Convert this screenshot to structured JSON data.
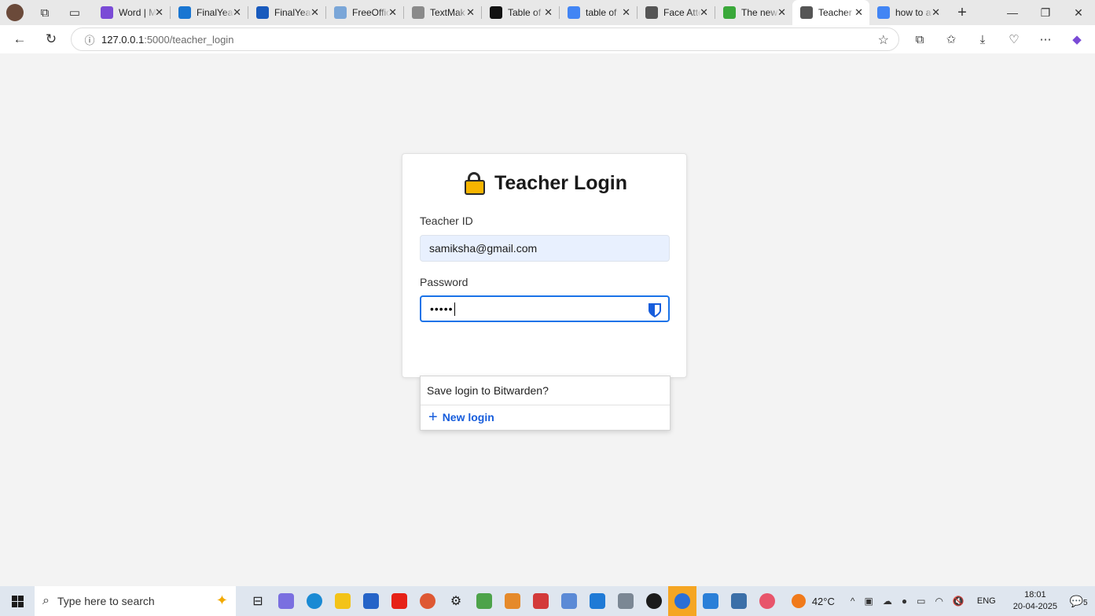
{
  "tabs": [
    {
      "title": "Word | M",
      "fav_color": "#7a4bd6",
      "icon": "copilot-icon"
    },
    {
      "title": "FinalYear",
      "fav_color": "#1976d2",
      "icon": "onedrive-icon"
    },
    {
      "title": "FinalYear",
      "fav_color": "#185abd",
      "icon": "word-icon"
    },
    {
      "title": "FreeOffic",
      "fav_color": "#7aa6d8",
      "icon": "freeoffice-icon"
    },
    {
      "title": "TextMak",
      "fav_color": "#8a8a8a",
      "icon": "globe-icon"
    },
    {
      "title": "Table of",
      "fav_color": "#111111",
      "icon": "chatgpt-icon"
    },
    {
      "title": "table of",
      "fav_color": "#4285f4",
      "icon": "google-icon"
    },
    {
      "title": "Face Atte",
      "fav_color": "#555555",
      "icon": "globe-icon"
    },
    {
      "title": "The new",
      "fav_color": "#3aa83a",
      "icon": "app-icon"
    },
    {
      "title": "Teacher L",
      "fav_color": "#555555",
      "icon": "globe-icon",
      "active": true
    },
    {
      "title": "how to a",
      "fav_color": "#4285f4",
      "icon": "google-icon"
    }
  ],
  "address": {
    "host": "127.0.0.1",
    "path": ":5000/teacher_login"
  },
  "card": {
    "title": "Teacher Login",
    "id_label": "Teacher ID",
    "id_value": "samiksha@gmail.com",
    "password_label": "Password",
    "password_value": "•••••"
  },
  "bitwarden": {
    "question": "Save login to Bitwarden?",
    "new_login": "New login",
    "color": "#175ddc"
  },
  "taskbar": {
    "search_placeholder": "Type here to search",
    "temperature": "42°C",
    "language": "ENG",
    "time": "18:01",
    "date": "20-04-2025",
    "notifications": "5"
  }
}
